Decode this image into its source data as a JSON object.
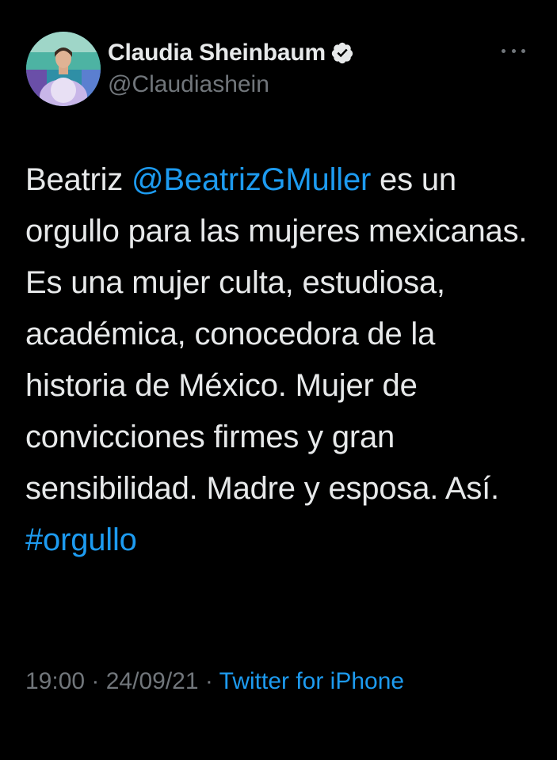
{
  "author": {
    "display_name": "Claudia Sheinbaum",
    "handle": "@Claudiashein",
    "verified_icon": "verified-badge-icon"
  },
  "tweet": {
    "text_before": "Beatriz ",
    "mention": "@BeatrizGMuller",
    "text_middle": " es un orgullo para las mujeres mexicanas. Es una mujer culta, estudiosa, académica, conocedora de la historia de México. Mujer de convicciones firmes y gran sensibilidad. Madre y esposa. Así. ",
    "hashtag": "#orgullo"
  },
  "meta": {
    "time": "19:00",
    "sep1": " · ",
    "date": "24/09/21",
    "sep2": " · ",
    "source": "Twitter for iPhone"
  },
  "colors": {
    "background": "#000000",
    "text": "#e7e9ea",
    "secondary": "#71767b",
    "link": "#1d9bf0"
  }
}
